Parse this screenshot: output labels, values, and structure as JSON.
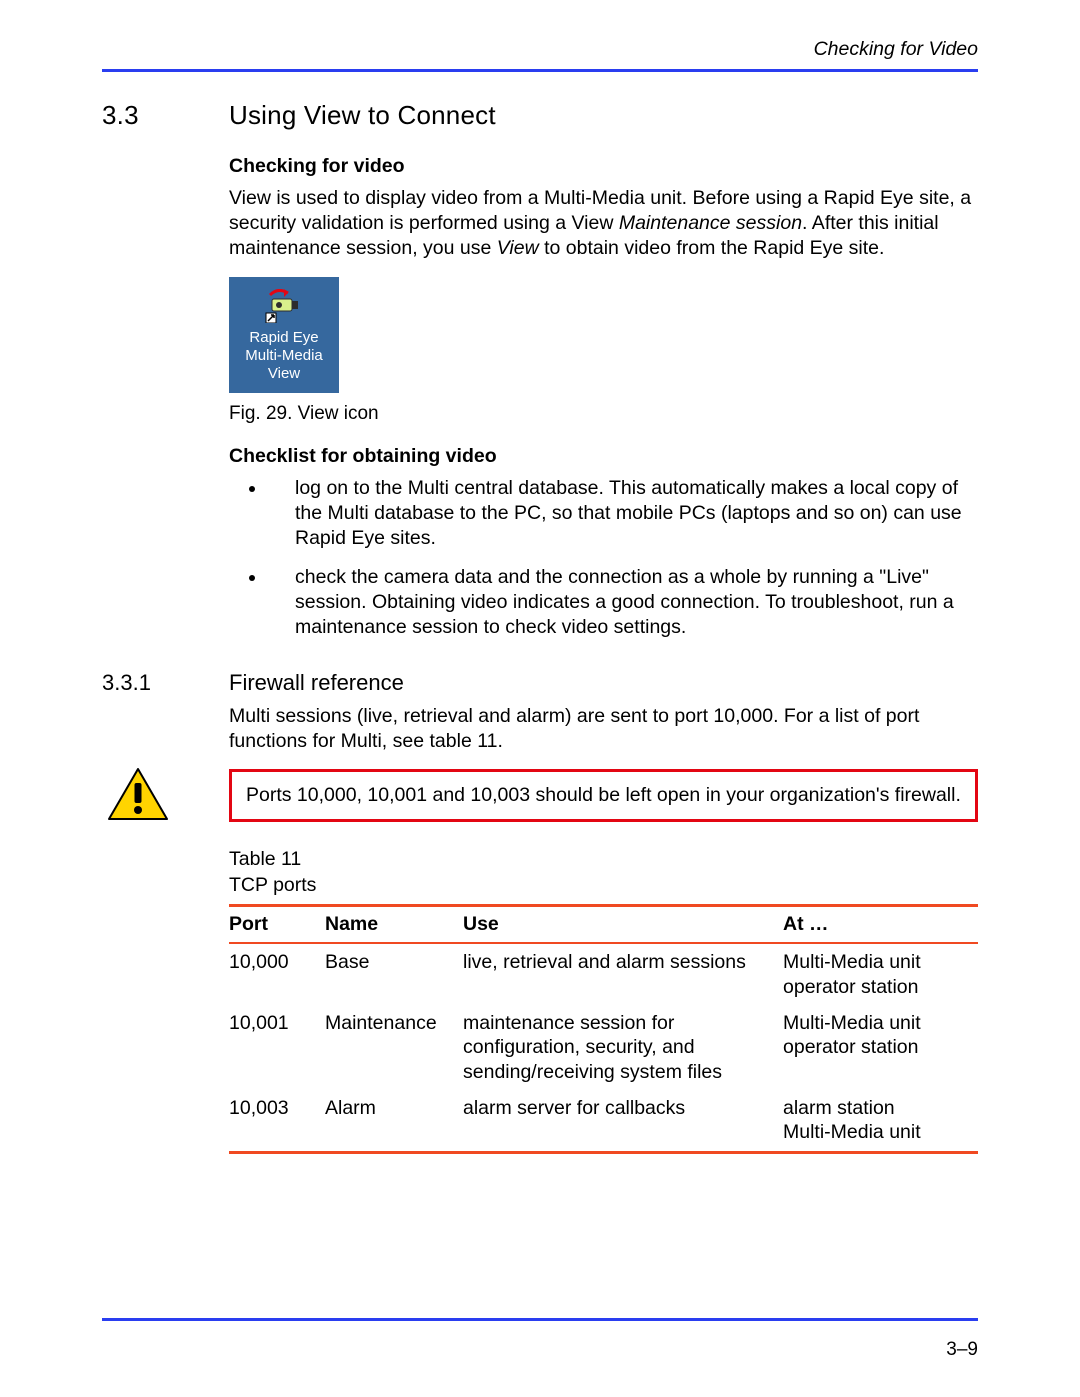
{
  "running_head": "Checking for Video",
  "section": {
    "number": "3.3",
    "title": "Using View to Connect"
  },
  "intro": {
    "heading": "Checking for video",
    "para_before_em1": "View is used to display video from a Multi-Media unit. Before using a Rapid Eye site, a security validation is performed using a View ",
    "em1": "Maintenance session",
    "para_mid": ". After this initial maintenance session, you use ",
    "em2": "View",
    "para_after": " to obtain video from the Rapid Eye site."
  },
  "icon": {
    "line1": "Rapid Eye",
    "line2": "Multi-Media",
    "line3": "View",
    "caption": "Fig. 29.  View icon"
  },
  "checklist": {
    "heading": "Checklist for obtaining video",
    "items": [
      "log on to the Multi central database. This automatically makes a local copy of the Multi database to the PC, so that mobile PCs (laptops and so on) can use Rapid Eye sites.",
      "check the camera data and the connection as a whole by running a \"Live\" session. Obtaining video indicates a good connection. To troubleshoot, run a maintenance session to check video settings."
    ]
  },
  "subsection": {
    "number": "3.3.1",
    "title": "Firewall reference",
    "para": "Multi sessions (live, retrieval and alarm) are sent to port 10,000. For a list of port functions for Multi, see table 11."
  },
  "warning": "Ports 10,000, 10,001 and 10,003 should be left open in your organization's firewall.",
  "table": {
    "caption_line1": "Table 11",
    "caption_line2": "TCP ports",
    "headers": {
      "port": "Port",
      "name": "Name",
      "use": "Use",
      "at": "At …"
    },
    "rows": [
      {
        "port": "10,000",
        "name": "Base",
        "use": "live, retrieval and alarm sessions",
        "at": "Multi-Media unit\noperator station"
      },
      {
        "port": "10,001",
        "name": "Maintenance",
        "use": "maintenance session for configuration, security, and sending/receiving system files",
        "at": "Multi-Media unit\noperator station"
      },
      {
        "port": "10,003",
        "name": "Alarm",
        "use": "alarm server for callbacks",
        "at": "alarm station\nMulti-Media unit"
      }
    ]
  },
  "page_number": "3–9"
}
